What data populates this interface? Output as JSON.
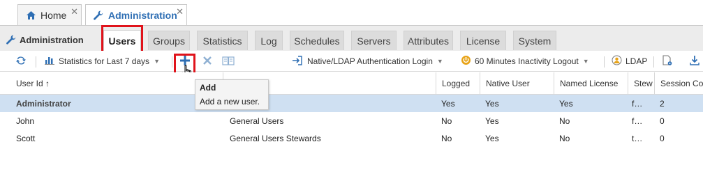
{
  "top_tabs": [
    {
      "label": "Home",
      "icon": "home-icon",
      "close": "✕"
    },
    {
      "label": "Administration",
      "icon": "wrench-icon",
      "close": "✕"
    }
  ],
  "sub_tabs": {
    "title": "Administration",
    "items": [
      "Users",
      "Groups",
      "Statistics",
      "Log",
      "Schedules",
      "Servers",
      "Attributes",
      "License",
      "System"
    ],
    "active": "Users"
  },
  "toolbar": {
    "statistics_label": "Statistics for Last 7 days",
    "auth_label": "Native/LDAP Authentication Login",
    "logout_label": "60 Minutes Inactivity Logout",
    "ldap_label": "LDAP"
  },
  "table": {
    "columns": [
      "User Id ↑",
      "",
      "Logged",
      "Native User",
      "Named License",
      "Stew",
      "Session Cou"
    ],
    "rows": [
      {
        "user": "Administrator",
        "group": "…tors",
        "logged": "Yes",
        "native": "Yes",
        "named": "Yes",
        "stew": "f…",
        "sessions": "2"
      },
      {
        "user": "John",
        "group": "General Users",
        "logged": "No",
        "native": "Yes",
        "named": "No",
        "stew": "f…",
        "sessions": "0"
      },
      {
        "user": "Scott",
        "group": "General Users Stewards",
        "logged": "No",
        "native": "Yes",
        "named": "No",
        "stew": "t…",
        "sessions": "0"
      }
    ]
  },
  "tooltip": {
    "title": "Add",
    "body": "Add a new user."
  },
  "colors": {
    "accent": "#2f6fb4",
    "highlight_red": "#e0131b",
    "selected_row": "#cfe0f2"
  }
}
